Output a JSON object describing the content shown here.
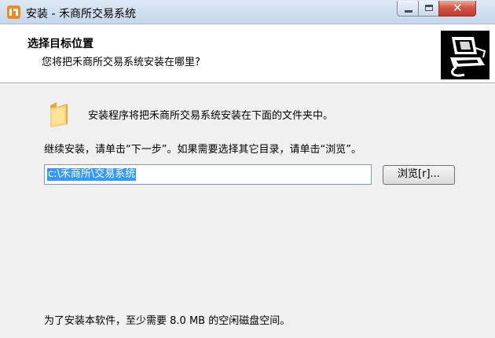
{
  "window": {
    "title": "安装 - 禾商所交易系统"
  },
  "header": {
    "title": "选择目标位置",
    "subtitle": "您将把禾商所交易系统安装在哪里?"
  },
  "body": {
    "info_line": "安装程序将把禾商所交易系统安装在下面的文件夹中。",
    "instruction": "继续安装，请单击“下一步”。如果需要选择其它目录，请单击“浏览”。",
    "install_path": "c:\\禾商所\\交易系统",
    "browse_label": "浏览[r]...",
    "space_note": "为了安装本软件，至少需要 8.0 MB 的空闲磁盘空间。"
  },
  "icons": {
    "app": "app-logo-icon",
    "folder": "folder-icon",
    "header_logo": "computer-install-icon"
  },
  "colors": {
    "selection": "#3399ff",
    "close_button": "#c03a2b",
    "folder": "#f2c35a"
  }
}
